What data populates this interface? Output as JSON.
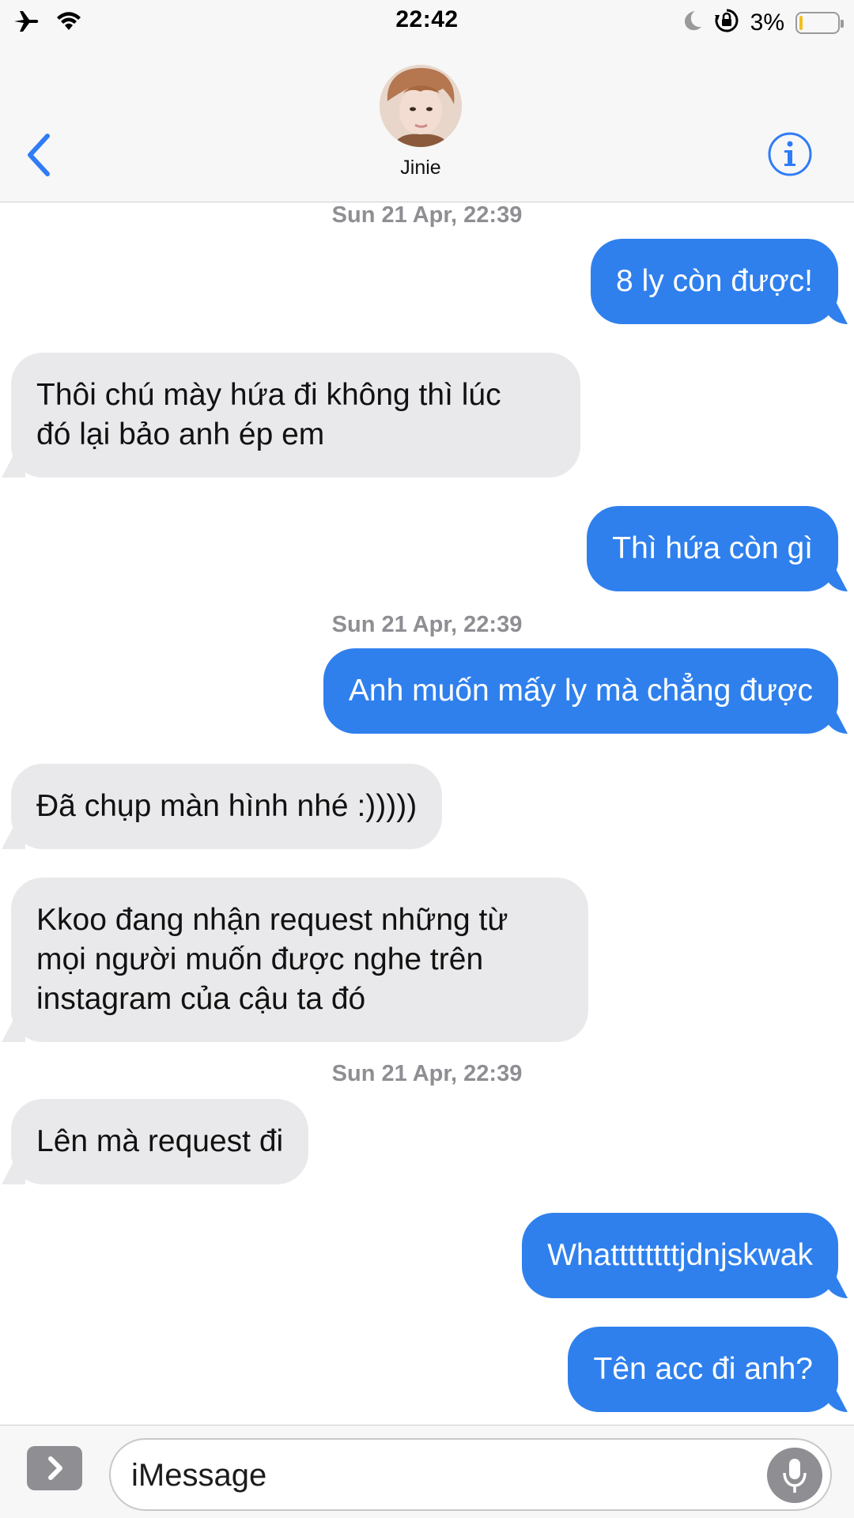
{
  "status_bar": {
    "time": "22:42",
    "battery_percent": "3%",
    "battery_level": 0.03,
    "icons": [
      "airplane-icon",
      "wifi-icon",
      "moon-icon",
      "rotation-lock-icon",
      "battery-icon"
    ]
  },
  "header": {
    "contact_name": "Jinie",
    "back_icon": "chevron-left-icon",
    "info_icon": "info-icon"
  },
  "messages": [
    {
      "type": "timestamp",
      "text": "Sun 21 Apr, 22:39"
    },
    {
      "type": "sent",
      "text": "8 ly còn được!"
    },
    {
      "type": "recv",
      "lines": [
        "Thôi chú mày hứa đi không thì lúc",
        "đó lại bảo anh ép em"
      ]
    },
    {
      "type": "sent",
      "text": "Thì hứa còn gì"
    },
    {
      "type": "timestamp",
      "text": "Sun 21 Apr, 22:39"
    },
    {
      "type": "sent",
      "text": "Anh muốn mấy ly mà chẳng được"
    },
    {
      "type": "recv",
      "text": "Đã chụp màn hình nhé :)))))"
    },
    {
      "type": "recv",
      "lines": [
        "Kkoo đang nhận request những từ",
        "mọi người muốn được nghe trên",
        "instagram của cậu ta đó"
      ]
    },
    {
      "type": "timestamp",
      "text": "Sun 21 Apr, 22:39"
    },
    {
      "type": "recv",
      "text": "Lên mà request đi"
    },
    {
      "type": "sent",
      "text": "Whattttttttjdnjskwak"
    },
    {
      "type": "sent",
      "text": "Tên acc đi anh?"
    }
  ],
  "input": {
    "placeholder": "iMessage",
    "value": ""
  },
  "colors": {
    "sent_bubble": "#2f80ed",
    "recv_bubble": "#e9e9eb",
    "accent": "#2f7cf6",
    "timestamp": "#8e8e93"
  }
}
